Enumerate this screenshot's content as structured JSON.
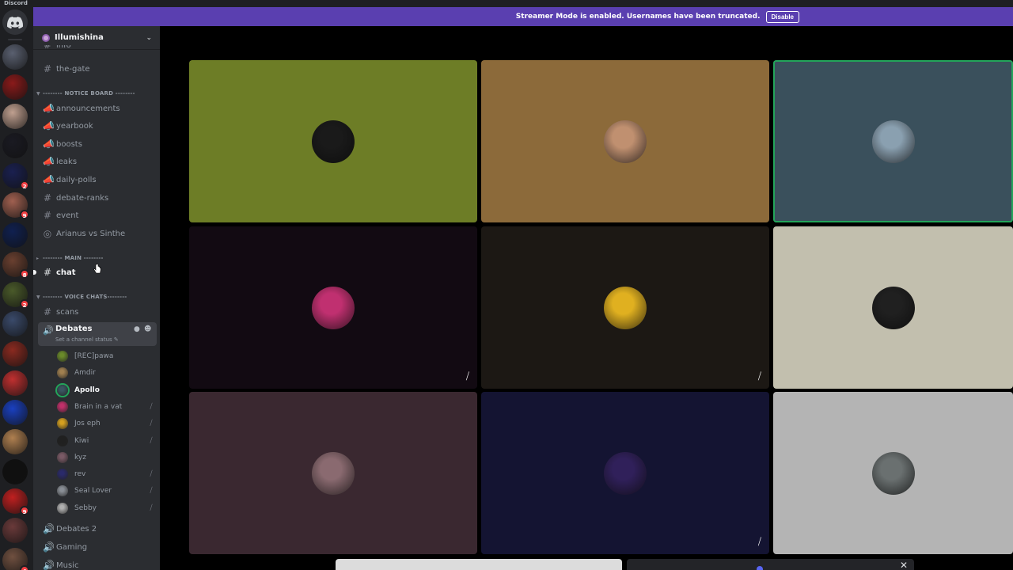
{
  "app": {
    "title": "Discord"
  },
  "banner": {
    "text": "Streamer Mode is enabled. Usernames have been truncated.",
    "button": "Disable"
  },
  "guild": {
    "name": "Illumishina"
  },
  "channels": {
    "partial_top": "info",
    "the_gate": "the-gate",
    "cat_notice": "-------- NOTICE BOARD --------",
    "announcements": "announcements",
    "yearbook": "yearbook",
    "boosts": "boosts",
    "leaks": "leaks",
    "daily_polls": "daily-polls",
    "debate_ranks": "debate-ranks",
    "event": "event",
    "stage": "Arianus vs Sinthe",
    "cat_main": "-------- MAIN --------",
    "chat": "chat",
    "cat_voice": "-------- VOICE CHATS--------",
    "scans": "scans",
    "debates": "Debates",
    "debates_status": "Set a channel status",
    "debates2": "Debates 2",
    "gaming": "Gaming",
    "music": "Music"
  },
  "voice_users": [
    {
      "name": "[REC]pawa",
      "deafened": false,
      "color": "#6a8a2a"
    },
    {
      "name": "Amdir",
      "deafened": false,
      "color": "#a08050"
    },
    {
      "name": "Apollo",
      "deafened": false,
      "color": "#3a5560"
    },
    {
      "name": "Brain in a vat",
      "deafened": true,
      "color": "#c0306a"
    },
    {
      "name": "Jos eph",
      "deafened": true,
      "color": "#d4a020"
    },
    {
      "name": "Kiwi",
      "deafened": true,
      "color": "#202020"
    },
    {
      "name": "kyz",
      "deafened": false,
      "color": "#7a5a66"
    },
    {
      "name": "rev",
      "deafened": true,
      "color": "#2a2a6a"
    },
    {
      "name": "Seal Lover",
      "deafened": true,
      "color": "#8a8f96"
    },
    {
      "name": "Sebby",
      "deafened": true,
      "color": "#b0b0b0"
    }
  ],
  "servers": [
    {
      "name": "server-1",
      "badge": "",
      "color": "#5a6070"
    },
    {
      "name": "server-2",
      "badge": "",
      "color": "#8a1a1a"
    },
    {
      "name": "server-3",
      "badge": "",
      "color": "#c0a090"
    },
    {
      "name": "server-4",
      "badge": "",
      "color": "#1a1a22"
    },
    {
      "name": "server-5",
      "badge": "2",
      "color": "#1a2050"
    },
    {
      "name": "server-6",
      "badge": "9",
      "color": "#a06050"
    },
    {
      "name": "server-7",
      "badge": "",
      "color": "#102050"
    },
    {
      "name": "server-8",
      "badge": "8",
      "color": "#6a4030"
    },
    {
      "name": "server-9",
      "badge": "2",
      "color": "#4a5a2a"
    },
    {
      "name": "server-10",
      "badge": "",
      "color": "#3a4a6a"
    },
    {
      "name": "server-11",
      "badge": "",
      "color": "#8a2a20"
    },
    {
      "name": "server-12",
      "badge": "",
      "color": "#c03030"
    },
    {
      "name": "server-13",
      "badge": "",
      "color": "#1a40c0"
    },
    {
      "name": "server-14",
      "badge": "",
      "color": "#b08050"
    },
    {
      "name": "server-15",
      "badge": "",
      "color": "#101010"
    },
    {
      "name": "server-16",
      "badge": "9",
      "color": "#c02020"
    },
    {
      "name": "server-17",
      "badge": "",
      "color": "#6a3a3a"
    },
    {
      "name": "server-18",
      "badge": "4",
      "color": "#705040"
    }
  ],
  "tiles": [
    {
      "bg": "#6d7d26",
      "avatar": "#1a1a1a",
      "speaking": false,
      "deafened": false
    },
    {
      "bg": "#8c6a3a",
      "avatar": "#c09070",
      "speaking": false,
      "deafened": false
    },
    {
      "bg": "#3a505c",
      "avatar": "#8aa0b0",
      "speaking": true,
      "deafened": false
    },
    {
      "bg": "#120a12",
      "avatar": "#c03070",
      "speaking": false,
      "deafened": true
    },
    {
      "bg": "#1c1814",
      "avatar": "#e0b020",
      "speaking": false,
      "deafened": true
    },
    {
      "bg": "#c2bfae",
      "avatar": "#202020",
      "speaking": false,
      "deafened": false
    },
    {
      "bg": "#3a2830",
      "avatar": "#8a6a70",
      "speaking": false,
      "deafened": false
    },
    {
      "bg": "#141432",
      "avatar": "#30205a",
      "speaking": false,
      "deafened": true
    },
    {
      "bg": "#b4b4b4",
      "avatar": "#6a7070",
      "speaking": false,
      "deafened": false
    }
  ]
}
